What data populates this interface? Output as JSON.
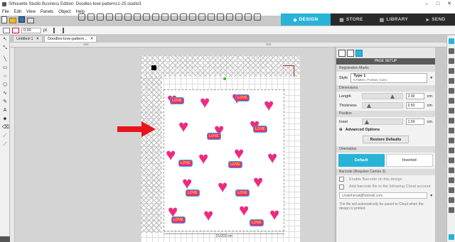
{
  "window": {
    "title": "Silhouette Studio Business Edition: Doodles-love-patterns1-25.studio3",
    "minimize": "–",
    "maximize": "□",
    "close": "✕"
  },
  "menu": [
    "File",
    "Edit",
    "View",
    "Panels",
    "Object",
    "Help"
  ],
  "nav": {
    "design": "DESIGN",
    "store": "STORE",
    "library": "LIBRARY",
    "send": "SEND"
  },
  "toolbar2": {
    "value": "0.00",
    "unit": "pt"
  },
  "tabs": [
    {
      "label": "Untitled-1",
      "close": "✕"
    },
    {
      "label": "Doodles-love-pattern...",
      "close": "✕"
    }
  ],
  "ruler": {
    "tick_100": "100",
    "tick_200": "200"
  },
  "canvas": {
    "dimension": "15.003 cm",
    "love_text": "LOVE",
    "arrow_color": "#e8141c"
  },
  "panel": {
    "title": "PAGE SETUP",
    "registration_marks": "Registration Marks",
    "style_label": "Style",
    "style_value": "Type 1",
    "style_sub": "CAMEO, Portrait, Curio",
    "dimensions": "Dimensions",
    "length_label": "Length",
    "length_value": "2.00",
    "length_unit": "cm",
    "thickness_label": "Thickness",
    "thickness_value": "0.50",
    "thickness_unit": "cm",
    "position": "Position",
    "inset_label": "Inset",
    "inset_value": "1.59",
    "inset_unit": "cm",
    "advanced": "Advanced Options",
    "restore": "Restore Defaults",
    "orientation": "Orientation",
    "orient_default": "Default",
    "orient_inverted": "Inverted",
    "barcode": "Barcode (Requires Cameo 3)",
    "enable_barcode": "Enable Barcode on this design",
    "add_barcode": "Add barcode file to the following Cloud account",
    "email": "cristiehecat@hotmail.com",
    "note": "The file will automatically be saved to Cloud when the design is printed."
  },
  "colors": {
    "accent": "#28b4d8",
    "heart": "#ee2a80",
    "love_yellow": "#f7d51d"
  }
}
